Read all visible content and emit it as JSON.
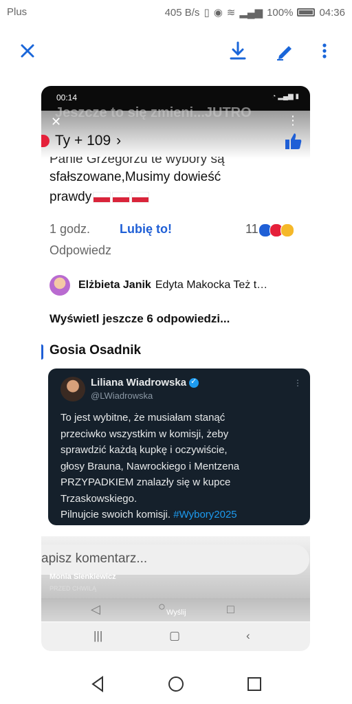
{
  "status_bar": {
    "carrier": "Plus",
    "speed": "405 B/s",
    "battery": "100%",
    "time": "04:36"
  },
  "toolbar": {
    "close_icon": "close-icon",
    "download_icon": "download-icon",
    "edit_icon": "edit-icon",
    "more_icon": "more-vert-icon"
  },
  "inner": {
    "status_time": "00:14",
    "ghost_text": "Jeszcze to się zmieni...JUTRO",
    "reactions": "Ty + 109",
    "comment_cut": "Panie Grzegorzu te wybory są",
    "comment_line2": "sfałszowane,Musimy dowieść",
    "comment_line3": "prawdy",
    "time_ago": "1 godz.",
    "like": "Lubię to!",
    "count": "11",
    "reply": "Odpowiedz",
    "reply1_name": "Elżbieta Janik",
    "reply1_text": "Edyta Makocka Też t…",
    "more_replies": "Wyświetl jeszcze 6 odpowiedzi...",
    "gosia": "Gosia Osadnik",
    "tweet": {
      "name": "Liliana Wiadrowska",
      "handle": "@LWiadrowska",
      "lines": [
        "To jest wybitne, że musiałam stanąć",
        "przeciwko wszystkim w komisji, żeby",
        "sprawdzić każdą kupkę i oczywiście,",
        "głosy Brauna, Nawrockiego i Mentzena",
        "PRZYPADKIEM znalazły się w kupce",
        "Trzaskowskiego."
      ],
      "last_line": "Pilnujcie swoich komisji.",
      "hashtag": "#Wybory2025"
    },
    "input_placeholder": "apisz komentarz...",
    "notif_name": "Monia Sienkiewicz",
    "notif_time": "PRZED CHWILĄ",
    "send": "Wyślij"
  }
}
